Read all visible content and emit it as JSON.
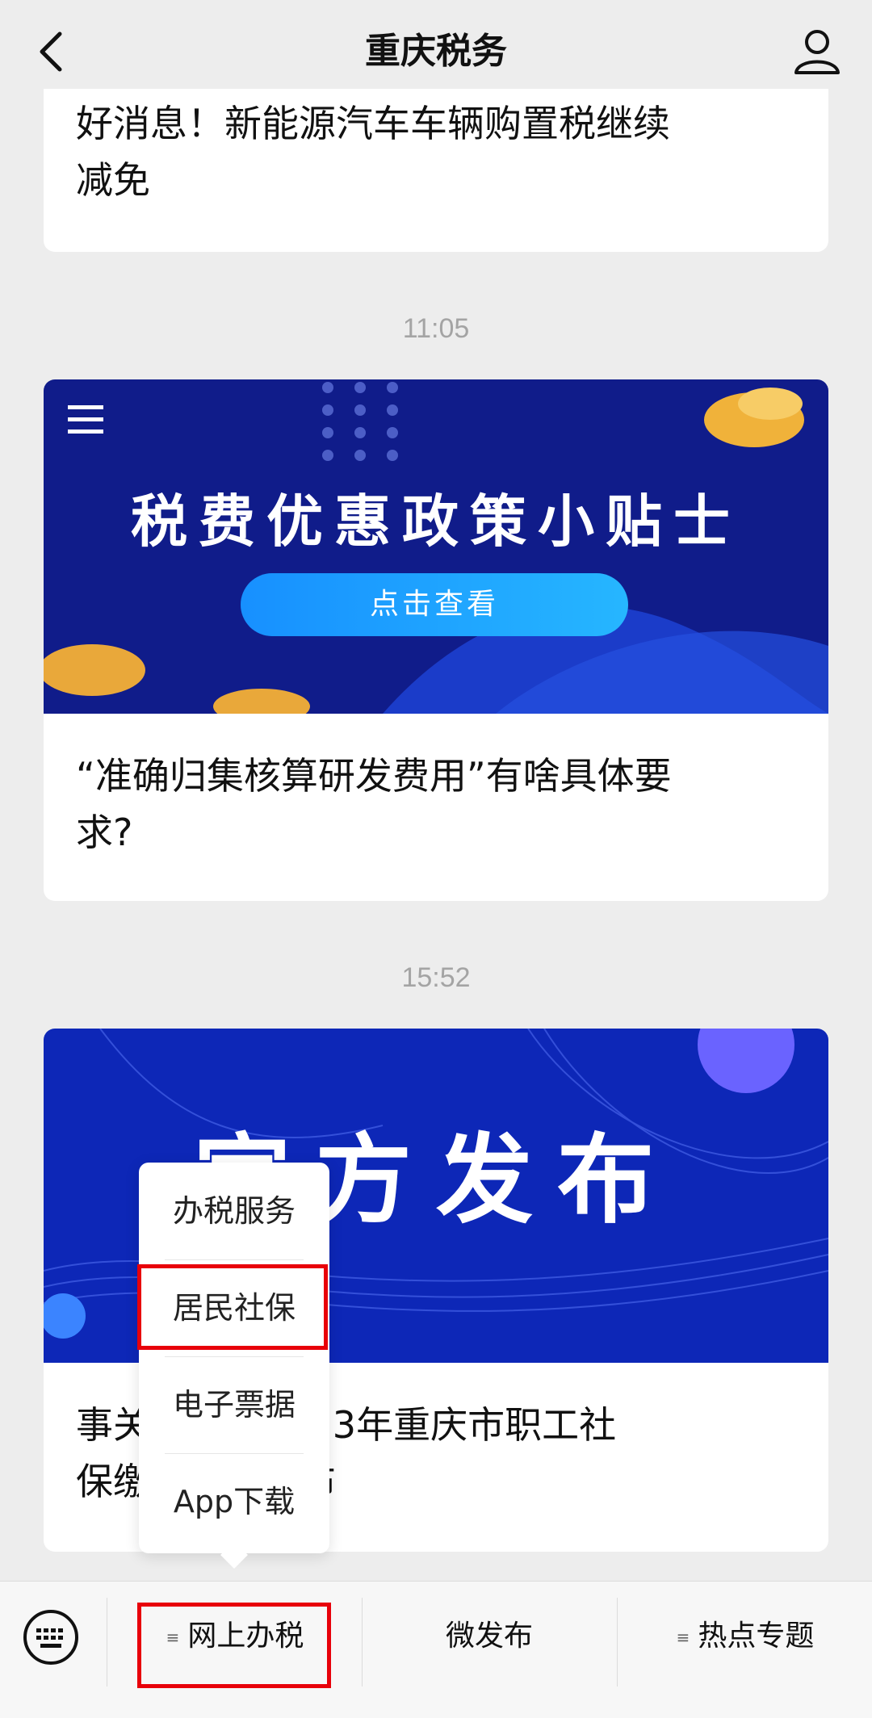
{
  "header": {
    "title": "重庆税务"
  },
  "cards": [
    {
      "title_line1": "好消息！新能源汽车车辆购置税继续",
      "title_line2": "减免"
    },
    {
      "banner_title": "税费优惠政策小贴士",
      "banner_button": "点击查看",
      "title_line1": "“准确归集核算研发费用”有啥具体要",
      "title_line2": "求?"
    },
    {
      "banner_title": "官方发布",
      "title_line1": "事关缴费！2023年重庆市职工社",
      "title_line2": "保缴费基数公布"
    }
  ],
  "times": [
    "11:05",
    "15:52"
  ],
  "popup_menu": {
    "items": [
      "办税服务",
      "居民社保",
      "电子票据",
      "App下载"
    ],
    "highlighted": "居民社保"
  },
  "bottom_menu": {
    "tabs": [
      "网上办税",
      "微发布",
      "热点专题"
    ],
    "highlighted": "网上办税"
  },
  "colors": {
    "highlight": "#e8000a",
    "banner1": "#101c8a",
    "banner2": "#0d27b7"
  }
}
